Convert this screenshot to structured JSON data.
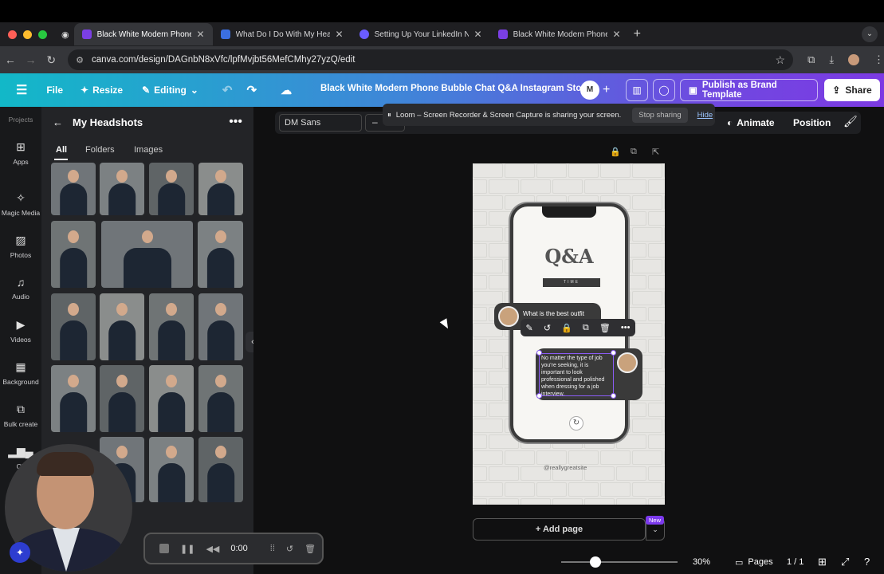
{
  "browser": {
    "tabs": [
      {
        "title": "Black White Modern Phone B...",
        "fav": "#7b3fe4",
        "active": true
      },
      {
        "title": "What Do I Do With My Headsh...",
        "fav": "#3b6fe0",
        "active": false
      },
      {
        "title": "Setting Up Your LinkedIn New...",
        "fav": "#6a5cff",
        "active": false
      },
      {
        "title": "Black White Modern Phone B...",
        "fav": "#7b3fe4",
        "active": false
      }
    ],
    "url": "canva.com/design/DAGnbN8xVfc/lpfMvjbt56MefCMhy27yzQ/edit"
  },
  "toolbar": {
    "file": "File",
    "resize": "Resize",
    "editing": "Editing",
    "doc_title": "Black White Modern Phone Bubble Chat Q&A Instagram Sto...",
    "avatar": "M",
    "publish": "Publish as Brand Template",
    "share": "Share"
  },
  "rail": {
    "projects": "Projects",
    "items": [
      "Apps",
      "Magic Media",
      "Photos",
      "Audio",
      "Videos",
      "Background",
      "Bulk create",
      "Ch"
    ]
  },
  "panel": {
    "title": "My Headshots",
    "tabs": [
      "All",
      "Folders",
      "Images"
    ]
  },
  "format": {
    "font": "DM Sans",
    "minus": "–",
    "animate": "Animate",
    "position": "Position"
  },
  "loom": {
    "message": "Loom – Screen Recorder & Screen Capture is sharing your screen.",
    "stop": "Stop sharing",
    "hide": "Hide"
  },
  "design": {
    "qa": "Q&A",
    "time": "TIME",
    "question": "What is the best outfit",
    "answer": "No matter the type of job you're seeking, it is important to look professional and polished when dressing for a job interview.",
    "handle": "@reallygreatsite"
  },
  "footer": {
    "add_page": "+ Add page",
    "new": "New",
    "zoom": "30%",
    "pages": "Pages",
    "page_count": "1 / 1"
  },
  "recorder": {
    "time": "0:00"
  },
  "colors": {
    "accent": "#7c3aed",
    "toolbar_start": "#12b8c8",
    "toolbar_end": "#7c3ae3"
  }
}
